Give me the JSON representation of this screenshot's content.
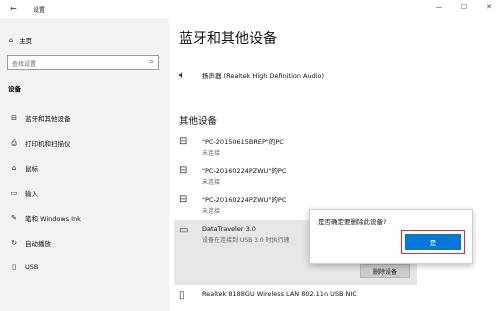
{
  "window": {
    "back_glyph": "←",
    "title": "设置",
    "minimize_glyph": "—",
    "maximize_glyph": "☐",
    "close_glyph": "✕"
  },
  "sidebar": {
    "home_label": "主页",
    "search_placeholder": "查找设置",
    "section_title": "设备",
    "items": [
      {
        "label": "蓝牙和其他设备",
        "icon": "bluetooth-icon",
        "glyph": "⊟"
      },
      {
        "label": "打印机和扫描仪",
        "icon": "printer-icon",
        "glyph": "⎙"
      },
      {
        "label": "鼠标",
        "icon": "mouse-icon",
        "glyph": "⌂"
      },
      {
        "label": "输入",
        "icon": "keyboard-icon",
        "glyph": "▭"
      },
      {
        "label": "笔和 Windows Ink",
        "icon": "pen-icon",
        "glyph": "✎"
      },
      {
        "label": "自动播放",
        "icon": "autoplay-icon",
        "glyph": "↻"
      },
      {
        "label": "USB",
        "icon": "usb-icon",
        "glyph": "▯"
      }
    ]
  },
  "main": {
    "title": "蓝牙和其他设备",
    "speaker_name": "扬声器 (Realtek High Definition Audio)",
    "other_devices_title": "其他设备",
    "devices": [
      {
        "name": "\"PC-20150615BREP\"的PC",
        "status": "未连接"
      },
      {
        "name": "\"PC-20160224PZWU\"的PC",
        "status": "未连接"
      },
      {
        "name": "\"PC-20160224PZWU\"的PC",
        "status": "未连接"
      }
    ],
    "selected_device": {
      "name": "DataTraveler 3.0",
      "status": "设备在连接到 USB 3.0 时执行速"
    },
    "remove_button": "删除设备",
    "last_device": "Realtek 8188GU Wireless LAN 802.11n USB NIC"
  },
  "popup": {
    "question": "是否确定要删除此设备?",
    "yes_label": "是"
  },
  "colors": {
    "accent": "#0078d7",
    "highlight_border": "#d9302c",
    "sidebar_bg": "#f2f2f2"
  }
}
